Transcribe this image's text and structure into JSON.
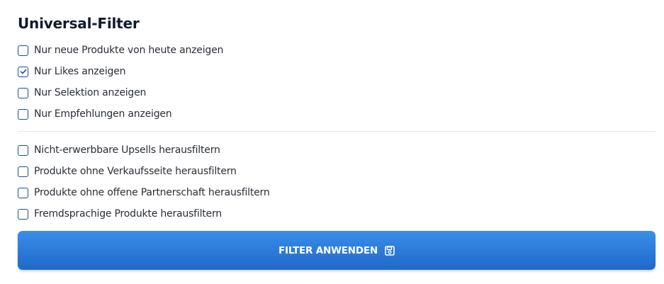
{
  "panel": {
    "title": "Universal-Filter"
  },
  "filters_group_1": [
    {
      "label": "Nur neue Produkte von heute anzeigen",
      "checked": false
    },
    {
      "label": "Nur Likes anzeigen",
      "checked": true
    },
    {
      "label": "Nur Selektion anzeigen",
      "checked": false
    },
    {
      "label": "Nur Empfehlungen anzeigen",
      "checked": false
    }
  ],
  "filters_group_2": [
    {
      "label": "Nicht-erwerbbare Upsells herausfiltern",
      "checked": false
    },
    {
      "label": "Produkte ohne Verkaufsseite herausfiltern",
      "checked": false
    },
    {
      "label": "Produkte ohne offene Partnerschaft herausfiltern",
      "checked": false
    },
    {
      "label": "Fremdsprachige Produkte herausfiltern",
      "checked": false
    }
  ],
  "apply_button": {
    "label": "FILTER ANWENDEN",
    "icon": "save-icon"
  },
  "colors": {
    "accent": "#2b79d8",
    "checkbox_border": "#1e4f8f",
    "title": "#0f1b2d"
  }
}
